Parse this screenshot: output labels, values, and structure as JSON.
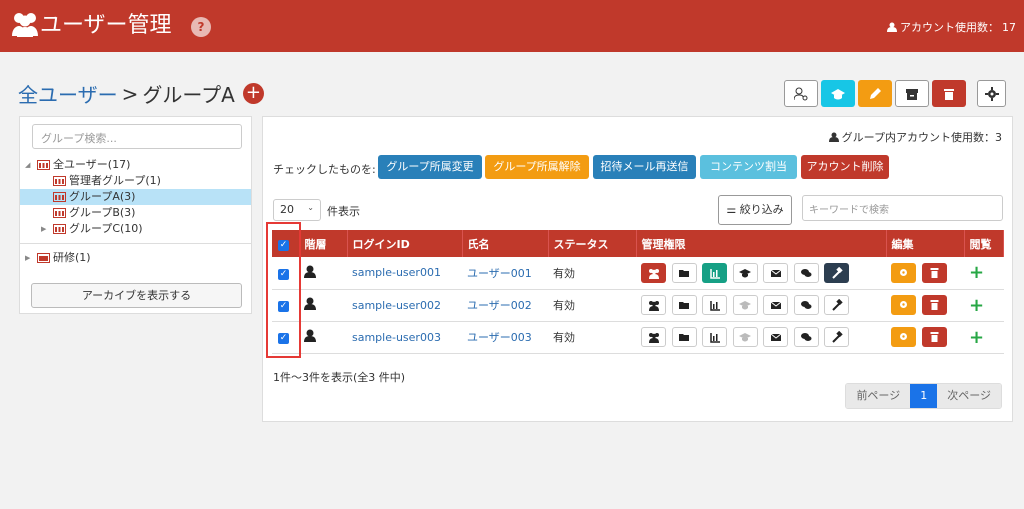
{
  "header": {
    "title": "ユーザー管理",
    "help": "?",
    "account_usage": "アカウント使用数：",
    "account_count": "17"
  },
  "breadcrumb": {
    "root": "全ユーザー",
    "separator": ">",
    "current": "グループA",
    "add": "+"
  },
  "sidebar": {
    "search_placeholder": "グループ検索...",
    "tree": [
      {
        "label": "全ユーザー(17)",
        "toggle": "◢"
      },
      {
        "label": "管理者グループ(1)"
      },
      {
        "label": "グループA(3)"
      },
      {
        "label": "グループB(3)"
      },
      {
        "label": "グループC(10)",
        "toggle": "▶"
      },
      {
        "label": "研修(1)",
        "toggle": "▶"
      }
    ],
    "archive_button": "アーカイブを表示する"
  },
  "main": {
    "group_usage": "グループ内アカウント使用数：3",
    "checked_label": "チェックしたものを:",
    "actions": [
      "グループ所属変更",
      "グループ所属解除",
      "招待メール再送信",
      "コンテンツ割当",
      "アカウント削除"
    ],
    "per_page": "20",
    "per_page_label": "件表示",
    "filter": "絞り込み",
    "keyword_placeholder": "キーワードで検索",
    "columns": [
      "階層",
      "ログインID",
      "氏名",
      "ステータス",
      "管理権限",
      "編集",
      "閲覧"
    ],
    "rows": [
      {
        "login": "sample-user001",
        "name": "ユーザー001",
        "status": "有効"
      },
      {
        "login": "sample-user002",
        "name": "ユーザー002",
        "status": "有効"
      },
      {
        "login": "sample-user003",
        "name": "ユーザー003",
        "status": "有効"
      }
    ],
    "summary": "1件〜3件を表示(全3 件中)",
    "pager": {
      "prev": "前ページ",
      "page": "1",
      "next": "次ページ"
    }
  },
  "colors": {
    "brand": "#c0392b",
    "blue": "#2b6cb0",
    "orange": "#f39c12",
    "teal": "#16a085",
    "cyan": "#17a2b8",
    "lightblue": "#5bc0de"
  }
}
